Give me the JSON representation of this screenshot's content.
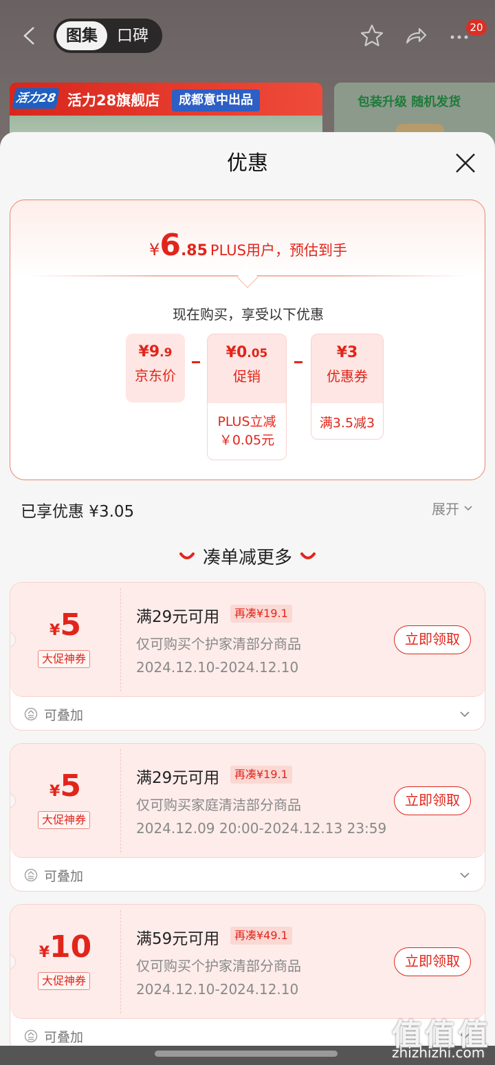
{
  "nav": {
    "tabs": [
      "图集",
      "口碑"
    ],
    "badge": "20"
  },
  "banner": {
    "logo_text": "活力28",
    "store_name": "活力28旗舰店",
    "tagline": "成都意中出品",
    "right_text": "包装升级 随机发货"
  },
  "sheet": {
    "title": "优惠"
  },
  "estimate": {
    "currency": "¥",
    "integer": "6",
    "decimal": ".85",
    "label": "PLUS用户，预估到手",
    "subtitle": "现在购买，享受以下优惠"
  },
  "breakdown": [
    {
      "currency": "¥",
      "int": "9",
      "dec": ".9",
      "label": "京东价"
    },
    {
      "currency": "¥",
      "int": "0",
      "dec": ".05",
      "label": "促销",
      "detail1": "PLUS立减",
      "detail2": "￥0.05元"
    },
    {
      "currency": "¥",
      "int": "3",
      "dec": "",
      "label": "优惠券",
      "detail1": "满3.5减3"
    }
  ],
  "enjoyed": {
    "text": "已享优惠 ¥3.05",
    "expand_label": "展开"
  },
  "more_title": "凑单减更多",
  "coupons": [
    {
      "currency": "¥",
      "amount": "5",
      "tag": "大促神券",
      "condition": "满29元可用",
      "need": "再凑¥19.1",
      "scope": "仅可购买个护家清部分商品",
      "date": "2024.12.10-2024.12.10",
      "button": "立即领取",
      "stack": "可叠加"
    },
    {
      "currency": "¥",
      "amount": "5",
      "tag": "大促神券",
      "condition": "满29元可用",
      "need": "再凑¥19.1",
      "scope": "仅可购买家庭清洁部分商品",
      "date": "2024.12.09 20:00-2024.12.13 23:59",
      "button": "立即领取",
      "stack": "可叠加"
    },
    {
      "currency": "¥",
      "amount": "10",
      "tag": "大促神券",
      "condition": "满59元可用",
      "need": "再凑¥49.1",
      "scope": "仅可购买个护家清部分商品",
      "date": "2024.12.10-2024.12.10",
      "button": "立即领取",
      "stack": "可叠加"
    }
  ],
  "watermark": {
    "mark": "值值值",
    "site": "zhizhizhi.com"
  },
  "colors": {
    "accent": "#e1251b",
    "coupon_bg": "#fdecea",
    "border": "#e7866f"
  }
}
